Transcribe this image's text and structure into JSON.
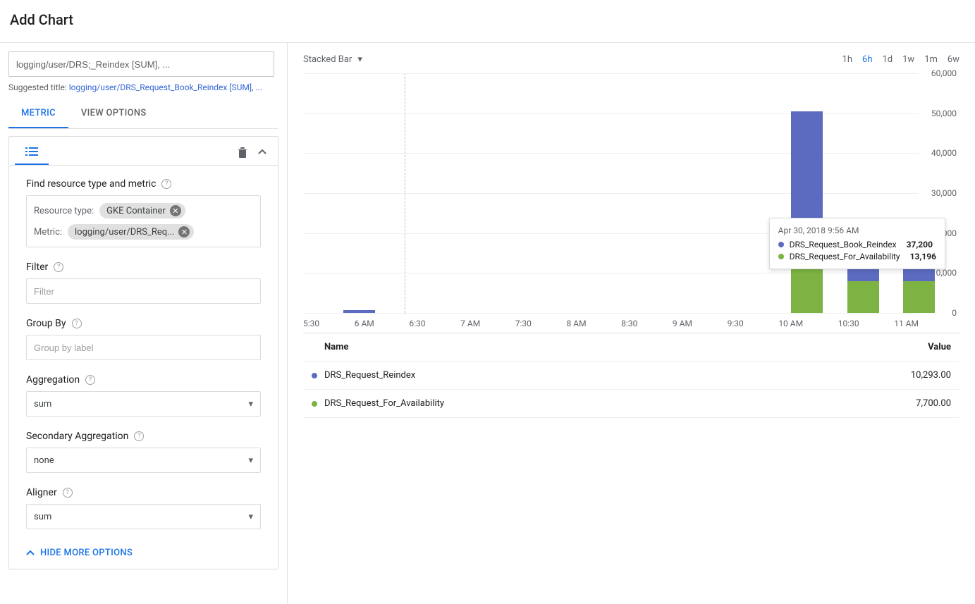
{
  "page": {
    "title": "Add Chart"
  },
  "title_input": {
    "value": "logging/user/DRS;_Reindex [SUM], ..."
  },
  "suggested": {
    "prefix": "Suggested title: ",
    "link": "logging/user/DRS_Request_Book_Reindex [SUM], ..."
  },
  "tabs": {
    "metric": "METRIC",
    "view_options": "VIEW OPTIONS"
  },
  "card": {
    "find_label": "Find resource type and metric",
    "resource_type_label": "Resource type:",
    "resource_type_chip": "GKE Container",
    "metric_label": "Metric:",
    "metric_chip": "logging/user/DRS_Req...",
    "filter_label": "Filter",
    "filter_placeholder": "Filter",
    "groupby_label": "Group By",
    "groupby_placeholder": "Group by label",
    "aggregation_label": "Aggregation",
    "aggregation_value": "sum",
    "secondary_label": "Secondary Aggregation",
    "secondary_value": "none",
    "aligner_label": "Aligner",
    "aligner_value": "sum",
    "hide_more": "HIDE MORE OPTIONS"
  },
  "chart": {
    "type_label": "Stacked Bar",
    "ranges": [
      "1h",
      "6h",
      "1d",
      "1w",
      "1m",
      "6w"
    ],
    "active_range": "6h",
    "y_ticks": [
      "60,000",
      "50,000",
      "40,000",
      "30,000",
      "20,000",
      "10,000",
      "0"
    ],
    "x_ticks": [
      "5:30",
      "6 AM",
      "6:30",
      "7 AM",
      "7:30",
      "8 AM",
      "8:30",
      "9 AM",
      "9:30",
      "10 AM",
      "10:30",
      "11 AM"
    ]
  },
  "chart_data": {
    "type": "bar",
    "stacked": true,
    "ylim": [
      0,
      60000
    ],
    "categories": [
      "5:30",
      "6 AM",
      "6:30",
      "7 AM",
      "7:30",
      "8 AM",
      "8:30",
      "9 AM",
      "9:30",
      "10 AM",
      "10:30",
      "11 AM"
    ],
    "series": [
      {
        "name": "DRS_Request_Book_Reindex",
        "color": "#5c6bc0",
        "values": [
          0,
          700,
          0,
          0,
          0,
          0,
          0,
          0,
          0,
          37200,
          6500,
          4000
        ]
      },
      {
        "name": "DRS_Request_For_Availability",
        "color": "#7cb342",
        "values": [
          0,
          0,
          0,
          0,
          0,
          0,
          0,
          0,
          0,
          13196,
          8000,
          8000
        ]
      }
    ]
  },
  "tooltip": {
    "time": "Apr 30, 2018 9:56 AM",
    "rows": [
      {
        "label": "DRS_Request_Book_Reindex",
        "value": "37,200"
      },
      {
        "label": "DRS_Request_For_Availability",
        "value": "13,196"
      }
    ]
  },
  "legend": {
    "name_header": "Name",
    "value_header": "Value",
    "rows": [
      {
        "color": "#5c6bc0",
        "name": "DRS_Request_Reindex",
        "value": "10,293.00"
      },
      {
        "color": "#7cb342",
        "name": "DRS_Request_For_Availability",
        "value": "7,700.00"
      }
    ]
  }
}
